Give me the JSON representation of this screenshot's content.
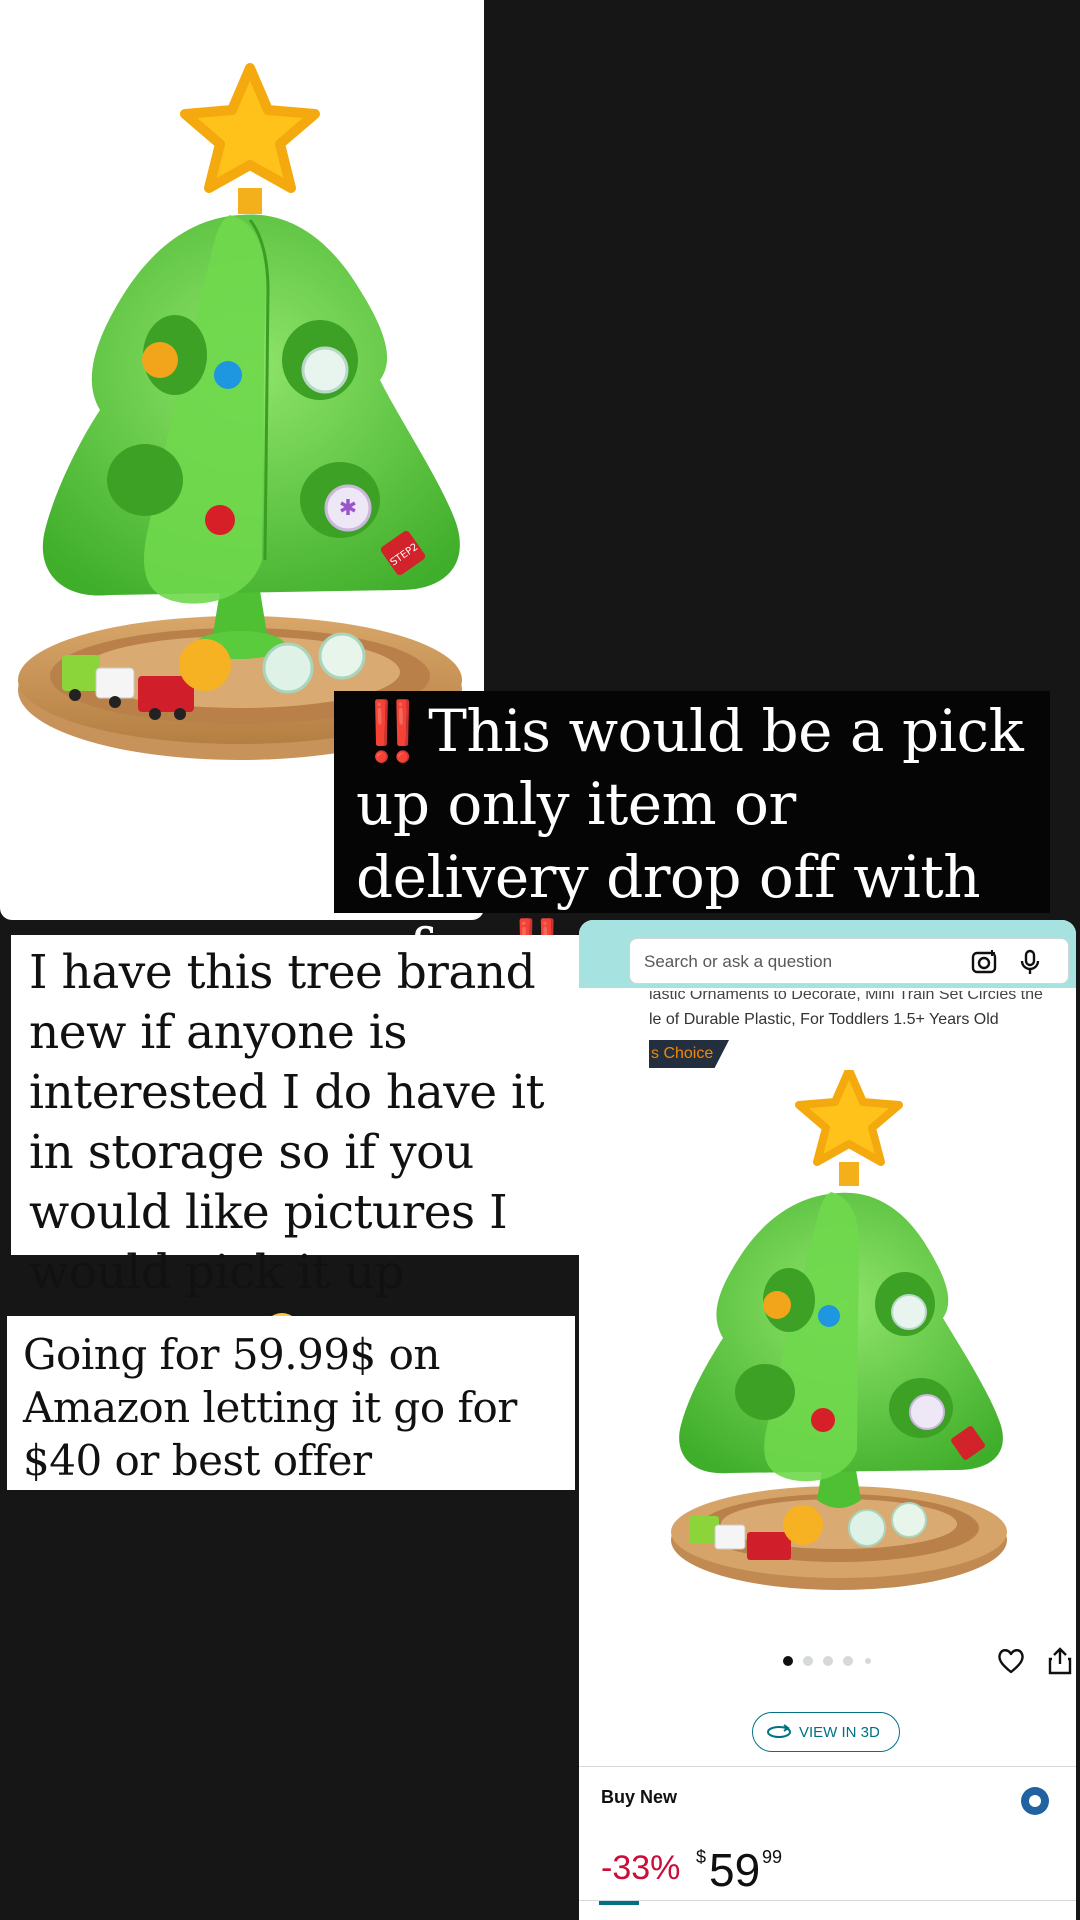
{
  "post": {
    "caption_top": {
      "bang_start": "‼️",
      "text": "This would be a pick up only item or delivery drop off with a fee",
      "bang_end": "‼️"
    },
    "caption_middle": {
      "text": "I have this tree brand new if anyone is interested I do have it in storage so if you would like pictures I would pick it up tomorrow",
      "emoji": "smiling-face-with-hearts-emoji"
    },
    "caption_bottom": {
      "text": "Going for 59.99$ on Amazon letting it go for $40 or best offer"
    },
    "product_photo": {
      "brand_tag": "STEP 2"
    }
  },
  "amazon": {
    "search": {
      "placeholder": "Search or ask a question",
      "camera_icon": "camera-icon",
      "mic_icon": "microphone-icon"
    },
    "title_line1": "lastic Ornaments to Decorate, Mini Train Set Circles the",
    "title_line2": "le of Durable Plastic, For Toddlers 1.5+ Years Old",
    "badge": "s Choice",
    "image_dots": {
      "count": 5,
      "active": 0
    },
    "favorite_icon": "heart-icon",
    "share_icon": "share-icon",
    "view_3d": "VIEW IN 3D",
    "buy_box": {
      "title": "Buy New",
      "discount": "-33%",
      "currency": "$",
      "price_whole": "59",
      "price_cents": "99"
    }
  },
  "colors": {
    "background": "#161616",
    "bang_red": "#e31b23",
    "amazon_header": "#a6e3e0",
    "amazon_link": "#007185",
    "discount_red": "#cc0c39",
    "tree_green": "#5ccf3e",
    "star_yellow": "#ffc21a"
  }
}
